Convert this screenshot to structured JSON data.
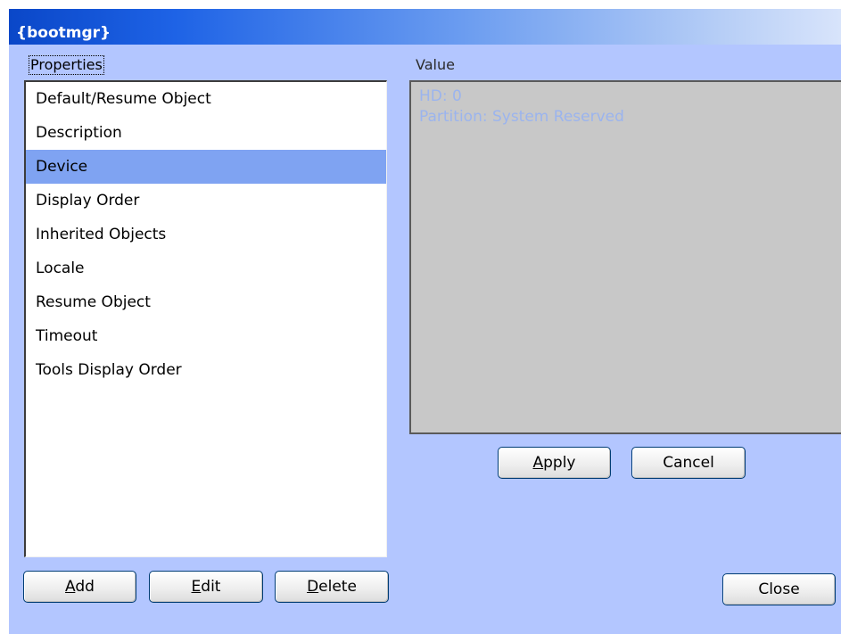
{
  "window": {
    "title": "{bootmgr}"
  },
  "labels": {
    "properties": "Properties",
    "value": "Value"
  },
  "properties": {
    "items": [
      "Default/Resume Object",
      "Description",
      "Device",
      "Display Order",
      "Inherited Objects",
      "Locale",
      "Resume Object",
      "Timeout",
      "Tools Display Order"
    ],
    "selected": "Device"
  },
  "value": {
    "lines": [
      "HD: 0",
      "Partition: System Reserved"
    ]
  },
  "buttons": {
    "apply": "Apply",
    "cancel": "Cancel",
    "add": "Add",
    "edit": "Edit",
    "delete": "Delete",
    "close": "Close"
  },
  "colors": {
    "window_bg": "#b3c6ff",
    "selection": "#7fa3f2",
    "value_bg": "#c8c8c8",
    "value_text": "#9bb4ee"
  }
}
